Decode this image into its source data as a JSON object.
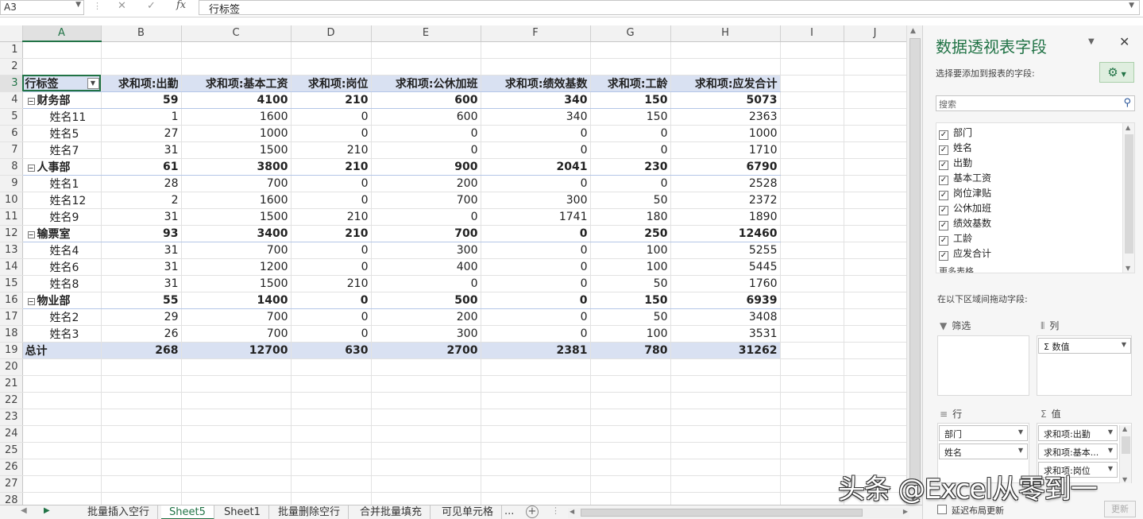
{
  "formula_bar": {
    "name_box": "A3",
    "content": "行标签"
  },
  "columns": [
    "A",
    "B",
    "C",
    "D",
    "E",
    "F",
    "G",
    "H",
    "I",
    "J"
  ],
  "row_numbers": [
    "1",
    "2",
    "3",
    "4",
    "5",
    "6",
    "7",
    "8",
    "9",
    "10",
    "11",
    "12",
    "13",
    "14",
    "15",
    "16",
    "17",
    "18",
    "19",
    "20",
    "21",
    "22",
    "23",
    "24",
    "25",
    "26",
    "27",
    "28"
  ],
  "pivot": {
    "headers": [
      "行标签",
      "求和项:出勤",
      "求和项:基本工资",
      "求和项:岗位",
      "求和项:公休加班",
      "求和项:绩效基数",
      "求和项:工龄",
      "求和项:应发合计"
    ],
    "rows": [
      {
        "type": "group",
        "label": "财务部",
        "values": [
          "59",
          "4100",
          "210",
          "600",
          "340",
          "150",
          "5073"
        ]
      },
      {
        "type": "item",
        "label": "姓名11",
        "values": [
          "1",
          "1600",
          "0",
          "600",
          "340",
          "150",
          "2363"
        ]
      },
      {
        "type": "item",
        "label": "姓名5",
        "values": [
          "27",
          "1000",
          "0",
          "0",
          "0",
          "0",
          "1000"
        ]
      },
      {
        "type": "item",
        "label": "姓名7",
        "values": [
          "31",
          "1500",
          "210",
          "0",
          "0",
          "0",
          "1710"
        ]
      },
      {
        "type": "group",
        "label": "人事部",
        "values": [
          "61",
          "3800",
          "210",
          "900",
          "2041",
          "230",
          "6790"
        ]
      },
      {
        "type": "item",
        "label": "姓名1",
        "values": [
          "28",
          "700",
          "0",
          "200",
          "0",
          "0",
          "2528"
        ]
      },
      {
        "type": "item",
        "label": "姓名12",
        "values": [
          "2",
          "1600",
          "0",
          "700",
          "300",
          "50",
          "2372"
        ]
      },
      {
        "type": "item",
        "label": "姓名9",
        "values": [
          "31",
          "1500",
          "210",
          "0",
          "1741",
          "180",
          "1890"
        ]
      },
      {
        "type": "group",
        "label": "输票室",
        "values": [
          "93",
          "3400",
          "210",
          "700",
          "0",
          "250",
          "12460"
        ]
      },
      {
        "type": "item",
        "label": "姓名4",
        "values": [
          "31",
          "700",
          "0",
          "300",
          "0",
          "100",
          "5255"
        ]
      },
      {
        "type": "item",
        "label": "姓名6",
        "values": [
          "31",
          "1200",
          "0",
          "400",
          "0",
          "100",
          "5445"
        ]
      },
      {
        "type": "item",
        "label": "姓名8",
        "values": [
          "31",
          "1500",
          "210",
          "0",
          "0",
          "50",
          "1760"
        ]
      },
      {
        "type": "group",
        "label": "物业部",
        "values": [
          "55",
          "1400",
          "0",
          "500",
          "0",
          "150",
          "6939"
        ]
      },
      {
        "type": "item",
        "label": "姓名2",
        "values": [
          "29",
          "700",
          "0",
          "200",
          "0",
          "50",
          "3408"
        ]
      },
      {
        "type": "item",
        "label": "姓名3",
        "values": [
          "26",
          "700",
          "0",
          "300",
          "0",
          "100",
          "3531"
        ]
      },
      {
        "type": "total",
        "label": "总计",
        "values": [
          "268",
          "12700",
          "630",
          "2700",
          "2381",
          "780",
          "31262"
        ]
      }
    ]
  },
  "sheet_tabs": {
    "tabs": [
      "批量插入空行",
      "Sheet5",
      "Sheet1",
      "批量删除空行",
      "合并批量填充",
      "可见单元格"
    ],
    "active": "Sheet5",
    "more": "...",
    "add": "+"
  },
  "pivot_pane": {
    "title": "数据透视表字段",
    "subtitle": "选择要添加到报表的字段:",
    "search_placeholder": "搜索",
    "fields": [
      "部门",
      "姓名",
      "出勤",
      "基本工资",
      "岗位津贴",
      "公休加班",
      "绩效基数",
      "工龄",
      "应发合计"
    ],
    "more_tables": "更多表格...",
    "drag_label": "在以下区域间拖动字段:",
    "zones": {
      "filter": {
        "label": "筛选",
        "items": []
      },
      "columns": {
        "label": "列",
        "items": [
          "Σ 数值"
        ]
      },
      "rows": {
        "label": "行",
        "items": [
          "部门",
          "姓名"
        ]
      },
      "values": {
        "label": "值",
        "items": [
          "求和项:出勤",
          "求和项:基本...",
          "求和项:岗位"
        ]
      }
    },
    "defer_label": "延迟布局更新",
    "update_button": "更新"
  },
  "watermark": "头条 @Excel从零到一",
  "colors": {
    "accent": "#217346",
    "pivot_header": "#d9e1f2"
  }
}
